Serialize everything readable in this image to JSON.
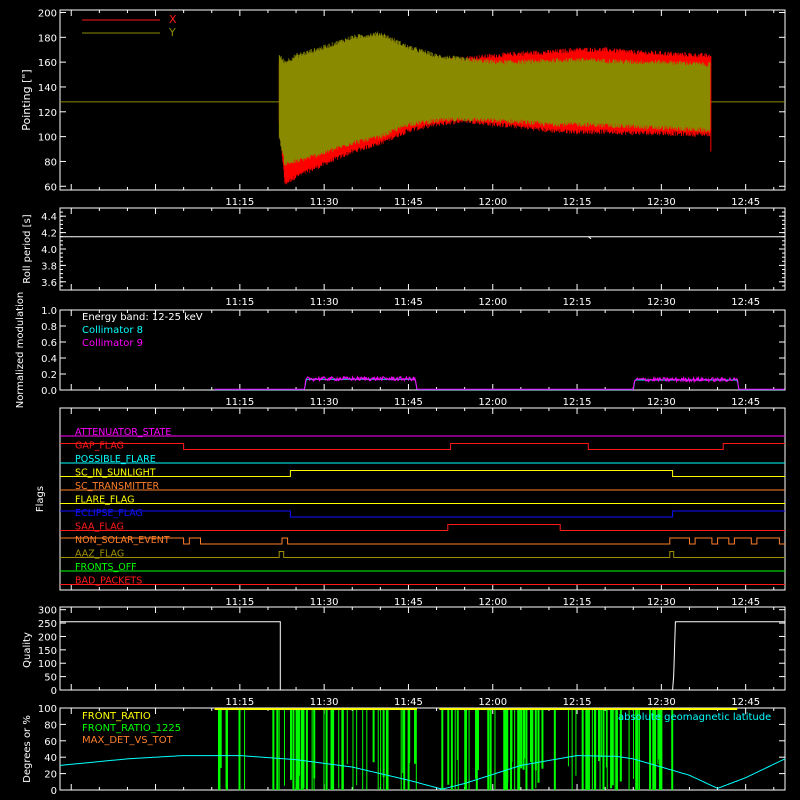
{
  "colors": {
    "background": "#000000",
    "axes": "#ffffff",
    "x_series": "#ff0000",
    "y_series": "#8a8a00",
    "cyan": "#00ffff",
    "magenta": "#ff00ff",
    "green": "#00ff00",
    "yellow": "#ffff00",
    "orange": "#ff7f2a",
    "red": "#ff1a1a",
    "blue": "#1010ff",
    "olive": "#a09000"
  },
  "time_axis": {
    "range_minutes": [
      -32,
      97
    ],
    "ticks": [
      {
        "t": 0,
        "label": "11:15"
      },
      {
        "t": 15,
        "label": "11:30"
      },
      {
        "t": 30,
        "label": "11:45"
      },
      {
        "t": 45,
        "label": "12:00"
      },
      {
        "t": 60,
        "label": "12:15"
      },
      {
        "t": 75,
        "label": "12:30"
      },
      {
        "t": 90,
        "label": "12:45"
      }
    ]
  },
  "chart_data": [
    {
      "type": "line",
      "ylabel": "Pointing [\"]",
      "ylim": [
        57,
        202
      ],
      "yticks": [
        60,
        80,
        100,
        120,
        140,
        160,
        180,
        200
      ],
      "legend": [
        "X",
        "Y"
      ],
      "legend_placement": "top-left",
      "baseline_value": 128,
      "oscillation_window_t": [
        7.0,
        83.8
      ],
      "series": [
        {
          "name": "X",
          "envelope_t": [
            7,
            8,
            10,
            15,
            20,
            25,
            30,
            35,
            40,
            45,
            50,
            55,
            60,
            65,
            70,
            75,
            80,
            83.5
          ],
          "envelope_upper": [
            160,
            130,
            140,
            150,
            152,
            153,
            158,
            160,
            163,
            165,
            167,
            168,
            170,
            170,
            168,
            167,
            166,
            165
          ],
          "envelope_lower": [
            112,
            62,
            68,
            78,
            88,
            95,
            105,
            110,
            113,
            110,
            108,
            105,
            104,
            104,
            103,
            103,
            102,
            102
          ]
        },
        {
          "name": "Y",
          "envelope_t": [
            7,
            8,
            10,
            15,
            20,
            25,
            30,
            35,
            40,
            45,
            50,
            55,
            60,
            65,
            70,
            75,
            80,
            83.5
          ],
          "envelope_upper": [
            165,
            160,
            165,
            172,
            180,
            183,
            172,
            165,
            162,
            160,
            160,
            161,
            162,
            161,
            160,
            160,
            159,
            158
          ],
          "envelope_lower": [
            100,
            78,
            80,
            87,
            95,
            100,
            110,
            113,
            114,
            113,
            112,
            110,
            110,
            109,
            108,
            107,
            106,
            105
          ]
        }
      ]
    },
    {
      "type": "line",
      "ylabel": "Roll period [s]",
      "ylim": [
        3.5,
        4.5
      ],
      "yticks": [
        3.6,
        3.8,
        4.0,
        4.2,
        4.4
      ],
      "series": [
        {
          "name": "",
          "value": 4.15
        }
      ]
    },
    {
      "type": "line",
      "ylabel": "Normalized modulation",
      "ylim": [
        0,
        1
      ],
      "yticks": [
        0.0,
        0.2,
        0.4,
        0.6,
        0.8,
        1.0
      ],
      "annotations": [
        "Energy band: 12-25 keV",
        "Collimator 8",
        "Collimator 9"
      ],
      "segments": [
        {
          "t": [
            -4.5,
            11.5,
            11.8,
            31.2,
            31.5,
            35.5
          ],
          "v": [
            0.01,
            0.01,
            0.14,
            0.14,
            0.01,
            0.01
          ]
        },
        {
          "t": [
            35.5,
            70.0,
            70.3,
            88.5,
            88.8,
            97
          ],
          "v": [
            0.01,
            0.01,
            0.13,
            0.13,
            0.01,
            0.01
          ]
        }
      ]
    },
    {
      "type": "line",
      "ylabel": "Flags",
      "flags": [
        {
          "label": "ATTENUATOR_STATE",
          "color": "#ff00ff",
          "t": [
            -32,
            97
          ],
          "v": [
            0,
            0
          ]
        },
        {
          "label": "GAP_FLAG",
          "color": "#ff1a1a",
          "t": [
            -32,
            -10,
            -10,
            37.5,
            37.5,
            62,
            62,
            86,
            86,
            97
          ],
          "v": [
            1,
            1,
            0,
            0,
            1,
            1,
            0,
            0,
            1,
            1
          ]
        },
        {
          "label": "POSSIBLE_FLARE",
          "color": "#00ffff",
          "t": [
            -32,
            97
          ],
          "v": [
            0,
            0
          ]
        },
        {
          "label": "SC_IN_SUNLIGHT",
          "color": "#ffff00",
          "t": [
            -32,
            9,
            9,
            77,
            77,
            97
          ],
          "v": [
            0,
            0,
            1,
            1,
            0,
            0
          ]
        },
        {
          "label": "SC_TRANSMITTER",
          "color": "#ff7f2a",
          "t": [
            -32,
            97
          ],
          "v": [
            0,
            0
          ]
        },
        {
          "label": "FLARE_FLAG",
          "color": "#ffff00",
          "t": [
            -32,
            97
          ],
          "v": [
            0,
            0
          ]
        },
        {
          "label": "ECLIPSE_FLAG",
          "color": "#1010ff",
          "t": [
            -32,
            9,
            9,
            77,
            77,
            97
          ],
          "v": [
            1,
            1,
            0,
            0,
            1,
            1
          ]
        },
        {
          "label": "SAA_FLAG",
          "color": "#ff1a1a",
          "t": [
            -32,
            37,
            37,
            57,
            57,
            97
          ],
          "v": [
            0,
            0,
            1,
            1,
            0,
            0
          ]
        },
        {
          "label": "NON_SOLAR_EVENT",
          "color": "#ff7f2a",
          "t": [
            -32,
            -10,
            -10,
            -9,
            -9,
            -7,
            -7,
            7.5,
            7.5,
            8.5,
            8.5,
            76.5,
            76.5,
            80,
            80,
            81,
            81,
            84,
            84,
            85,
            85,
            87,
            87,
            88,
            88,
            91,
            91,
            92,
            92,
            96,
            96,
            97
          ],
          "v": [
            1,
            1,
            0,
            0,
            1,
            1,
            0,
            0,
            1,
            1,
            0,
            0,
            1,
            1,
            0,
            0,
            1,
            1,
            0,
            0,
            1,
            1,
            0,
            0,
            1,
            1,
            0,
            0,
            1,
            1,
            0,
            0
          ]
        },
        {
          "label": "AAZ_FLAG",
          "color": "#a09000",
          "t": [
            -32,
            7,
            7,
            7.8,
            7.8,
            76.5,
            76.5,
            77.2,
            77.2,
            97
          ],
          "v": [
            0,
            0,
            1,
            1,
            0,
            0,
            1,
            1,
            0,
            0
          ]
        },
        {
          "label": "FRONTS_OFF",
          "color": "#00ff00",
          "t": [
            -32,
            97
          ],
          "v": [
            0,
            0
          ]
        },
        {
          "label": "BAD_PACKETS",
          "color": "#ff1a1a",
          "t": [
            -32,
            97
          ],
          "v": [
            0,
            0
          ]
        }
      ]
    },
    {
      "type": "line",
      "ylabel": "Quality",
      "ylim": [
        0,
        310
      ],
      "yticks": [
        0,
        50,
        100,
        150,
        200,
        250,
        300
      ],
      "series": [
        {
          "name": "",
          "t": [
            -32,
            7.2,
            7.2,
            77.0,
            77.2,
            77.5,
            97
          ],
          "v": [
            255,
            255,
            0,
            0,
            55,
            255,
            255
          ]
        }
      ]
    },
    {
      "type": "line",
      "ylabel": "Degrees or %",
      "ylim": [
        0,
        100
      ],
      "yticks": [
        0,
        20,
        40,
        60,
        80,
        100
      ],
      "legend": [
        "FRONT_RATIO",
        "FRONT_RATIO_1225",
        "MAX_DET_VS_TOT",
        "absolute geomagnetic latitude"
      ],
      "series": [
        {
          "name": "absolute geomagnetic latitude",
          "t": [
            -32,
            -20,
            -10,
            0,
            10,
            20,
            30,
            36,
            40,
            50,
            60,
            67,
            70,
            80,
            85,
            90,
            97
          ],
          "v": [
            30,
            38,
            42,
            42,
            37,
            28,
            12,
            1,
            8,
            30,
            42,
            41,
            38,
            18,
            2,
            15,
            38
          ]
        },
        {
          "name": "FRONT_RATIO",
          "t": [
            -4.5,
            31.5,
            35.5,
            88.5
          ],
          "v": [
            100,
            100,
            100,
            100
          ]
        }
      ],
      "green_bursts": [
        {
          "t0": -4.5,
          "t1": 1.5,
          "count": 7
        },
        {
          "t0": 5,
          "t1": 31.5,
          "count": 48
        },
        {
          "t0": 35.5,
          "t1": 57,
          "count": 38
        },
        {
          "t0": 57,
          "t1": 77,
          "count": 40
        }
      ]
    }
  ]
}
